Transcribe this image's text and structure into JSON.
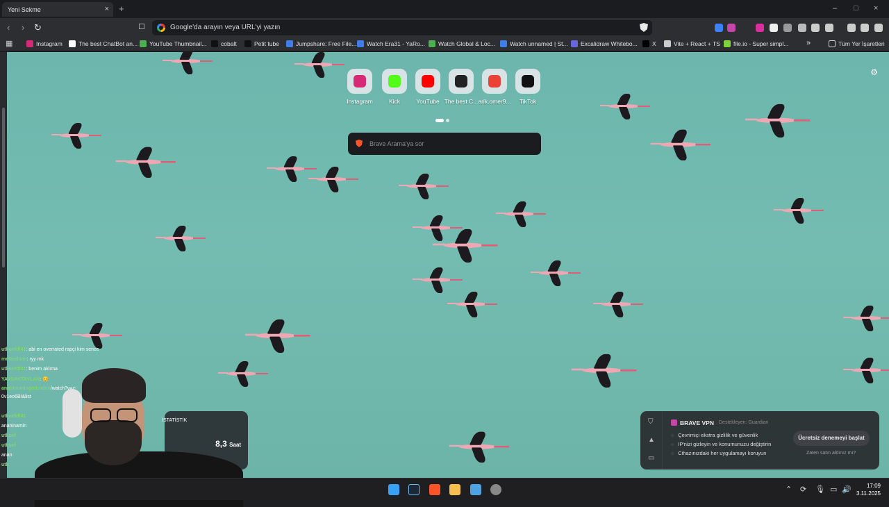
{
  "tab": {
    "title": "Yeni Sekme",
    "close": "×",
    "new": "+"
  },
  "window": {
    "minimize": "–",
    "maximize": "□",
    "close": "×"
  },
  "nav": {
    "back": "‹",
    "forward": "›",
    "reload": "↻",
    "bookmark": "☐"
  },
  "url": {
    "text": "Google'da arayın veya URL'yi yazın"
  },
  "bookmarks": [
    {
      "label": "Instagram",
      "color": "#d62976"
    },
    {
      "label": "The best ChatBot an...",
      "color": "#ffffff"
    },
    {
      "label": "YouTube Thumbnail...",
      "color": "#4caf50"
    },
    {
      "label": "cobalt",
      "color": "#111111"
    },
    {
      "label": "Petit tube",
      "color": "#111111"
    },
    {
      "label": "Jumpshare: Free File...",
      "color": "#3f7ee8"
    },
    {
      "label": "Watch Era31 - YaRo...",
      "color": "#3f7ee8"
    },
    {
      "label": "Watch Global & Loc...",
      "color": "#4caf50"
    },
    {
      "label": "Watch unnamed | St...",
      "color": "#3f7ee8"
    },
    {
      "label": "Excalidraw Whitebo...",
      "color": "#6965db"
    },
    {
      "label": "X",
      "color": "#000000"
    },
    {
      "label": "Vite + React + TS",
      "color": "#cccccc"
    },
    {
      "label": "file.io - Super simpl...",
      "color": "#7cd43a"
    }
  ],
  "bookmarks_more": "»",
  "bookmarks_all": "Tüm Yer İşaretleri",
  "shortcuts": [
    {
      "label": "Instagram",
      "color": "#d62976"
    },
    {
      "label": "Kick",
      "color": "#53fc18"
    },
    {
      "label": "YouTube",
      "color": "#ff0000"
    },
    {
      "label": "The best C...",
      "color": "#222222"
    },
    {
      "label": "arik.omer9...",
      "color": "#ea4335"
    },
    {
      "label": "TikTok",
      "color": "#111111"
    }
  ],
  "search": {
    "placeholder": "Brave Arama'ya sor"
  },
  "vpn": {
    "title": "BRAVE VPN",
    "by": "Destekleyen: Guardian",
    "items": [
      "Çevrimiçi ekstra gizlilik ve güvenlik",
      "IP'nizi gizleyin ve konumunuzu değiştirin",
      "Cihazınızdaki her uygulamayı koruyun"
    ],
    "button": "Ücretsiz denemeyi başlat",
    "link": "Zaten satın aldınız mı?"
  },
  "chat": [
    {
      "user": "utkuefdf41",
      "text": ": abi en overrated rapçi kim sence"
    },
    {
      "user": "mefasdsan",
      "text": ": ryy mk"
    },
    {
      "user": "utkuefdf41",
      "text": ": benim aklıma"
    },
    {
      "user": "YAVSAKTAYLAN",
      "text": ": 😊"
    },
    {
      "user": "ananinamingotunden",
      "text": "/watch?v=z-"
    },
    {
      "user": "0v1eo6BI&list",
      "text": ""
    },
    {
      "user": "utkuefdf41",
      "text": ""
    },
    {
      "user": "ananinamin",
      "text": ""
    },
    {
      "user": "utkuef",
      "text": ""
    },
    {
      "user": "utkuef",
      "text": ""
    },
    {
      "user": "anan",
      "text": ""
    },
    {
      "user": "utk",
      "text": ""
    }
  ],
  "stats": {
    "label": "İSTATİSTİK",
    "value": "8,3",
    "unit": "Saat"
  },
  "clock": {
    "time": "17:09",
    "date": "3.11.2025"
  }
}
